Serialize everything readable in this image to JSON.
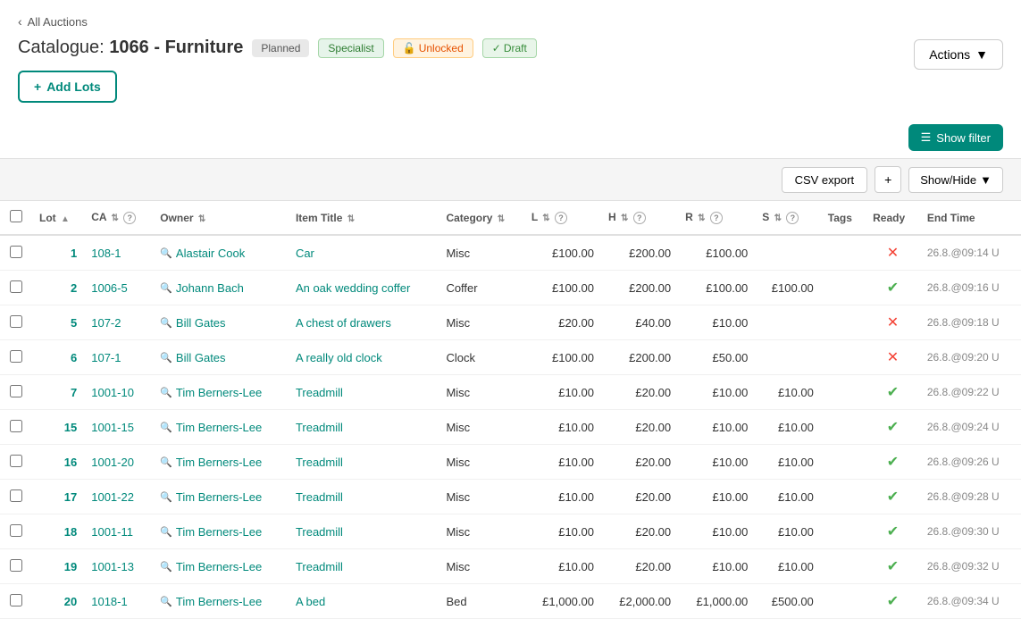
{
  "nav": {
    "back_label": "All Auctions"
  },
  "catalogue": {
    "prefix": "Catalogue:",
    "title": "1066 - Furniture",
    "badges": [
      {
        "label": "Planned",
        "type": "planned"
      },
      {
        "label": "Specialist",
        "type": "specialist"
      },
      {
        "label": "🔓 Unlocked",
        "type": "unlocked"
      },
      {
        "label": "✓ Draft",
        "type": "draft"
      }
    ]
  },
  "actions_btn": "Actions",
  "add_lots_btn": "+ Add Lots",
  "show_filter_btn": "Show filter",
  "csv_export_btn": "CSV export",
  "plus_btn": "+",
  "show_hide_btn": "Show/Hide",
  "columns": [
    {
      "key": "lot",
      "label": "Lot",
      "sortable": true
    },
    {
      "key": "ca",
      "label": "CA",
      "sortable": true,
      "help": true
    },
    {
      "key": "owner",
      "label": "Owner",
      "sortable": true
    },
    {
      "key": "item_title",
      "label": "Item Title",
      "sortable": true
    },
    {
      "key": "category",
      "label": "Category",
      "sortable": true
    },
    {
      "key": "l",
      "label": "L",
      "sortable": true,
      "help": true
    },
    {
      "key": "h",
      "label": "H",
      "sortable": true,
      "help": true
    },
    {
      "key": "r",
      "label": "R",
      "sortable": true,
      "help": true
    },
    {
      "key": "s",
      "label": "S",
      "sortable": true,
      "help": true
    },
    {
      "key": "tags",
      "label": "Tags",
      "sortable": false
    },
    {
      "key": "ready",
      "label": "Ready",
      "sortable": false
    },
    {
      "key": "end_time",
      "label": "End Time",
      "sortable": false
    }
  ],
  "rows": [
    {
      "lot": 1,
      "ca": "108-1",
      "owner": "Alastair Cook",
      "item_title": "Car",
      "category": "Misc",
      "l": "£100.00",
      "h": "£200.00",
      "r": "£100.00",
      "s": "",
      "tags": "",
      "ready": "cross",
      "end_time": "26.8.@09:14 U"
    },
    {
      "lot": 2,
      "ca": "1006-5",
      "owner": "Johann Bach",
      "item_title": "An oak wedding coffer",
      "category": "Coffer",
      "l": "£100.00",
      "h": "£200.00",
      "r": "£100.00",
      "s": "£100.00",
      "tags": "",
      "ready": "check",
      "end_time": "26.8.@09:16 U"
    },
    {
      "lot": 5,
      "ca": "107-2",
      "owner": "Bill Gates",
      "item_title": "A chest of drawers",
      "category": "Misc",
      "l": "£20.00",
      "h": "£40.00",
      "r": "£10.00",
      "s": "",
      "tags": "",
      "ready": "cross",
      "end_time": "26.8.@09:18 U"
    },
    {
      "lot": 6,
      "ca": "107-1",
      "owner": "Bill Gates",
      "item_title": "A really old clock",
      "category": "Clock",
      "l": "£100.00",
      "h": "£200.00",
      "r": "£50.00",
      "s": "",
      "tags": "",
      "ready": "cross",
      "end_time": "26.8.@09:20 U"
    },
    {
      "lot": 7,
      "ca": "1001-10",
      "owner": "Tim Berners-Lee",
      "item_title": "Treadmill",
      "category": "Misc",
      "l": "£10.00",
      "h": "£20.00",
      "r": "£10.00",
      "s": "£10.00",
      "tags": "",
      "ready": "check",
      "end_time": "26.8.@09:22 U"
    },
    {
      "lot": 15,
      "ca": "1001-15",
      "owner": "Tim Berners-Lee",
      "item_title": "Treadmill",
      "category": "Misc",
      "l": "£10.00",
      "h": "£20.00",
      "r": "£10.00",
      "s": "£10.00",
      "tags": "",
      "ready": "check",
      "end_time": "26.8.@09:24 U"
    },
    {
      "lot": 16,
      "ca": "1001-20",
      "owner": "Tim Berners-Lee",
      "item_title": "Treadmill",
      "category": "Misc",
      "l": "£10.00",
      "h": "£20.00",
      "r": "£10.00",
      "s": "£10.00",
      "tags": "",
      "ready": "check",
      "end_time": "26.8.@09:26 U"
    },
    {
      "lot": 17,
      "ca": "1001-22",
      "owner": "Tim Berners-Lee",
      "item_title": "Treadmill",
      "category": "Misc",
      "l": "£10.00",
      "h": "£20.00",
      "r": "£10.00",
      "s": "£10.00",
      "tags": "",
      "ready": "check",
      "end_time": "26.8.@09:28 U"
    },
    {
      "lot": 18,
      "ca": "1001-11",
      "owner": "Tim Berners-Lee",
      "item_title": "Treadmill",
      "category": "Misc",
      "l": "£10.00",
      "h": "£20.00",
      "r": "£10.00",
      "s": "£10.00",
      "tags": "",
      "ready": "check",
      "end_time": "26.8.@09:30 U"
    },
    {
      "lot": 19,
      "ca": "1001-13",
      "owner": "Tim Berners-Lee",
      "item_title": "Treadmill",
      "category": "Misc",
      "l": "£10.00",
      "h": "£20.00",
      "r": "£10.00",
      "s": "£10.00",
      "tags": "",
      "ready": "check",
      "end_time": "26.8.@09:32 U"
    },
    {
      "lot": 20,
      "ca": "1018-1",
      "owner": "Tim Berners-Lee",
      "item_title": "A bed",
      "category": "Bed",
      "l": "£1,000.00",
      "h": "£2,000.00",
      "r": "£1,000.00",
      "s": "£500.00",
      "tags": "",
      "ready": "check",
      "end_time": "26.8.@09:34 U"
    }
  ]
}
